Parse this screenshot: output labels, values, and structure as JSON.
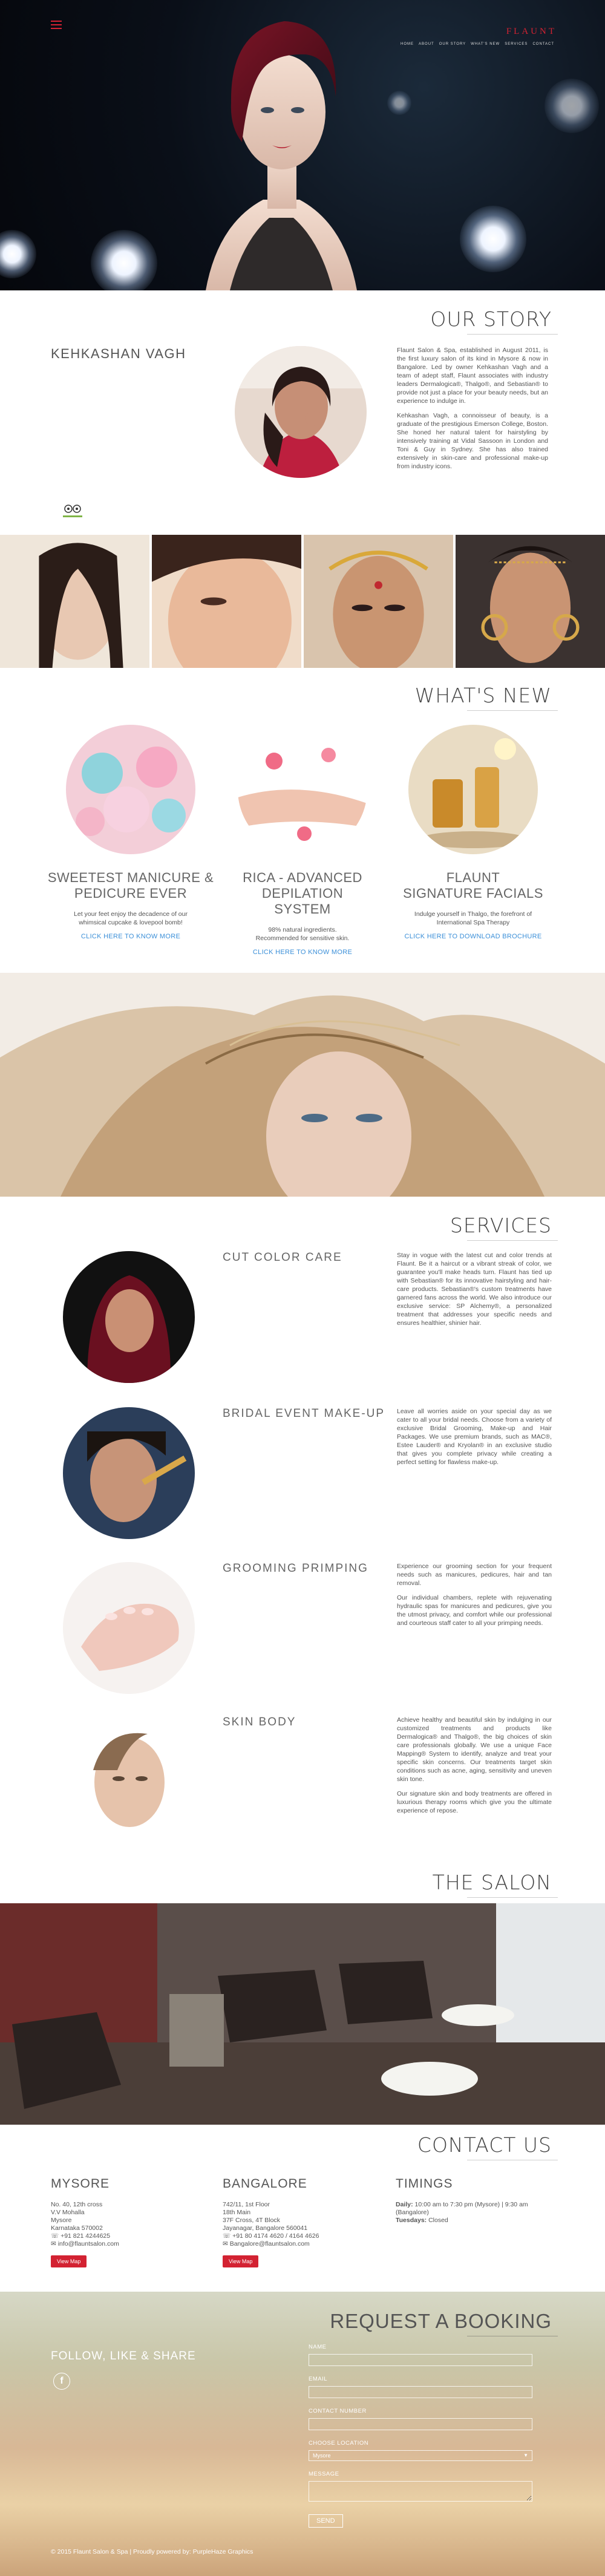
{
  "header": {
    "logo": "FLAUNT",
    "nav": [
      "HOME",
      "ABOUT",
      "OUR STORY",
      "WHAT'S NEW",
      "SERVICES",
      "CONTACT"
    ]
  },
  "story": {
    "title": "OUR STORY",
    "owner": "KEHKASHAN VAGH",
    "paragraphs": [
      "Flaunt Salon & Spa, established in August 2011, is the first luxury salon of its kind in Mysore & now in Bangalore. Led by owner Kehkashan Vagh and a team of adept staff, Flaunt associates with industry leaders Dermalogica®, Thalgo®, and Sebastian® to provide not just a place for your beauty needs, but an experience to indulge in.",
      "Kehkashan Vagh, a connoisseur of beauty, is a graduate of the prestigious Emerson College, Boston. She honed her natural talent for hairstyling by intensively training at Vidal Sassoon in London and Toni & Guy in Sydney. She has also trained extensively in skin-care and professional make-up from industry icons."
    ],
    "badge": "tripadvisor"
  },
  "whatsnew": {
    "title": "WHAT'S NEW",
    "cards": [
      {
        "title1": "SWEETEST MANICURE &",
        "title2": "PEDICURE EVER",
        "desc1": "Let your feet enjoy the decadence of our",
        "desc2": "whimsical cupcake & lovepool bomb!",
        "link": "CLICK HERE TO KNOW MORE"
      },
      {
        "title1": "RICA - ADVANCED DEPILATION",
        "title2": "SYSTEM",
        "desc1": "98% natural ingredients.",
        "desc2": "Recommended for sensitive skin.",
        "link": "CLICK HERE TO KNOW MORE"
      },
      {
        "title1": "FLAUNT",
        "title2": "SIGNATURE FACIALS",
        "desc1": "Indulge yourself in Thalgo, the forefront of",
        "desc2": "International Spa Therapy",
        "link": "CLICK HERE TO DOWNLOAD BROCHURE"
      }
    ]
  },
  "services": {
    "title": "SERVICES",
    "items": [
      {
        "name": "CUT  COLOR  CARE",
        "paragraphs": [
          "Stay in vogue with the latest cut and color trends at Flaunt. Be it a haircut or a vibrant streak of color, we guarantee you'll make heads turn. Flaunt has tied up with Sebastian® for its innovative hairstyling and hair-care products. Sebastian®'s custom treatments have garnered fans across the world. We also introduce our exclusive service: SP Alchemy®, a personalized treatment that addresses your specific needs and ensures healthier, shinier hair."
        ]
      },
      {
        "name": "BRIDAL EVENT MAKE-UP",
        "paragraphs": [
          "Leave all worries aside on your special day as we cater to all your bridal needs. Choose from a variety of exclusive Bridal Grooming, Make-up and Hair Packages. We use premium brands, such as MAC®, Estee Lauder® and Kryolan® in an exclusive studio that gives you complete privacy while creating a perfect setting for flawless make-up."
        ]
      },
      {
        "name": "GROOMING  PRIMPING",
        "paragraphs": [
          "Experience our grooming section for your frequent needs such as manicures, pedicures, hair and tan removal.",
          "Our individual chambers, replete with rejuvenating hydraulic spas for manicures and pedicures, give you the utmost privacy, and comfort while our professional and courteous staff cater to all your primping needs."
        ]
      },
      {
        "name": "SKIN  BODY",
        "paragraphs": [
          "Achieve healthy and beautiful skin by indulging in our customized treatments and products like Dermalogica® and Thalgo®, the big choices of skin care professionals globally. We use a unique Face Mapping® System to identify, analyze and treat your specific skin concerns. Our treatments target skin conditions such as acne, aging, sensitivity and uneven skin tone.",
          "Our signature skin and body treatments are offered in luxurious therapy rooms which give you the ultimate experience of repose."
        ]
      }
    ]
  },
  "salon": {
    "title": "THE SALON"
  },
  "contact": {
    "title": "CONTACT US",
    "mysore": {
      "head": "MYSORE",
      "lines": [
        "No. 40, 12th cross",
        "V.V Mohalla",
        "Mysore",
        "Karnataka 570002",
        "+91 821 4244625",
        "info@flauntsalon.com"
      ],
      "button": "View Map"
    },
    "bangalore": {
      "head": "BANGALORE",
      "lines": [
        "742/11, 1st Floor",
        "18th Main",
        "37F Cross, 4T Block",
        "Jayanagar, Bangalore 560041",
        "+91 80 4174 4620 / 4164 4626",
        "Bangalore@flauntsalon.com"
      ],
      "button": "View Map"
    },
    "timings": {
      "head": "TIMINGS",
      "line1_bold": "Daily:",
      "line1": " 10:00 am to 7:30 pm (Mysore) | 9:30 am (Bangalore)",
      "line2_bold": "Tuesdays:",
      "line2": " Closed"
    }
  },
  "booking": {
    "title": "REQUEST A BOOKING",
    "follow": "FOLLOW, LIKE & SHARE",
    "labels": {
      "name": "NAME",
      "email": "EMAIL",
      "contact": "CONTACT NUMBER",
      "location": "CHOOSE LOCATION",
      "message": "MESSAGE"
    },
    "location_value": "Mysore",
    "send": "SEND"
  },
  "footer": {
    "text": "© 2015 Flaunt Salon & Spa | Proudly powered by: PurpleHaze Graphics"
  },
  "colors": {
    "accent": "#d32232",
    "link": "#3b8fd8"
  }
}
